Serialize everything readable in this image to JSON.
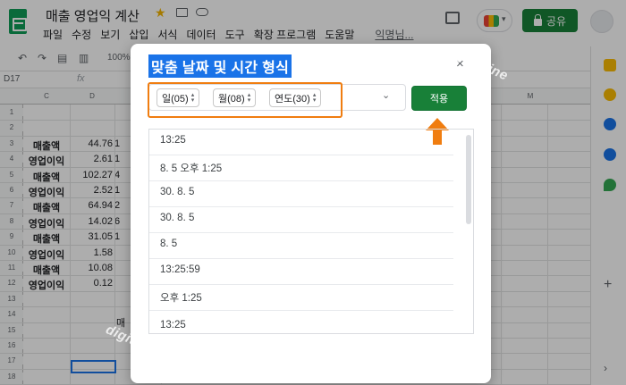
{
  "app": {
    "title": "매출 영업익 계산",
    "menu": [
      "파일",
      "수정",
      "보기",
      "삽입",
      "서식",
      "데이터",
      "도구",
      "확장 프로그램",
      "도움말"
    ],
    "last_edit": "익명님..."
  },
  "header": {
    "share_label": "공유"
  },
  "toolbar": {
    "zoom": "100%"
  },
  "formula_bar": {
    "name_box": "D17",
    "fx": "fx"
  },
  "grid": {
    "columns": [
      "C",
      "D",
      "M"
    ],
    "rows": [
      "1",
      "2",
      "3",
      "4",
      "5",
      "6",
      "7",
      "8",
      "9",
      "10",
      "11",
      "12",
      "13",
      "14",
      "15",
      "16",
      "17",
      "18"
    ],
    "labels": [
      "매출액",
      "영업이익",
      "매출액",
      "영업이익",
      "매출액",
      "영업이익",
      "매출액",
      "영업이익",
      "매출액",
      "영업이익"
    ],
    "values": [
      "44.76",
      "2.61",
      "102.27",
      "2.52",
      "64.94",
      "14.02",
      "31.05",
      "1.58",
      "10.08",
      "0.12"
    ],
    "values_col_e": [
      "1",
      "1",
      "4",
      "1",
      "2",
      "6",
      "1",
      "",
      "",
      ""
    ],
    "row15_text": "매"
  },
  "dialog": {
    "title": "맞춤 날짜 및 시간 형식",
    "close": "×",
    "chips": [
      {
        "label": "일(05)"
      },
      {
        "label": "월(08)"
      },
      {
        "label": "연도(30)"
      }
    ],
    "apply_label": "적용",
    "formats": [
      "13:25",
      "8. 5 오후 1:25",
      "30. 8. 5",
      "30. 8. 5",
      "8. 5",
      "13:25:59",
      "오후 1:25",
      "13:25"
    ]
  },
  "watermark": {
    "text": "digitalline"
  },
  "colors": {
    "accent": "#1a73e8",
    "brand_green": "#188038",
    "highlight_orange": "#f07d10"
  }
}
